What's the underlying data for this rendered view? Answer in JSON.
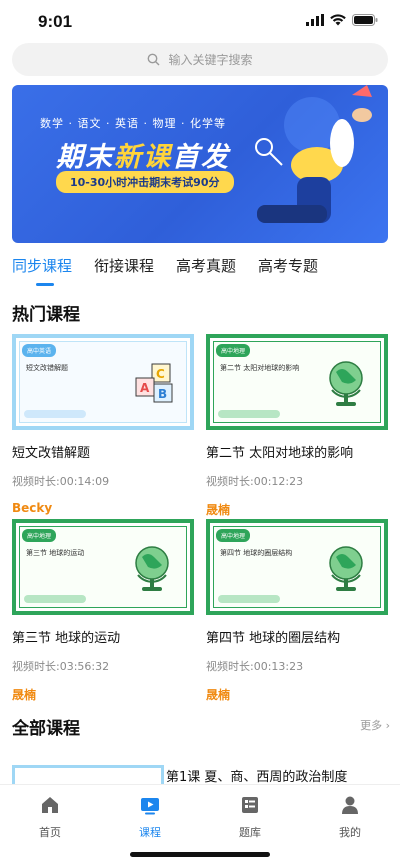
{
  "status": {
    "time": "9:01"
  },
  "search": {
    "placeholder": "输入关键字搜索"
  },
  "banner": {
    "subjects": "数学 · 语文 · 英语 · 物理 · 化学等",
    "headline_pre": "期末",
    "headline_hl": "新课",
    "headline_post": "首发",
    "pill": "10-30小时冲击期末考试90分"
  },
  "tabs": [
    {
      "label": "同步课程",
      "active": true
    },
    {
      "label": "衔接课程"
    },
    {
      "label": "高考真题"
    },
    {
      "label": "高考专题"
    }
  ],
  "hot": {
    "title": "热门课程",
    "courses": [
      {
        "tag": "高中英语",
        "thumb_title": "短文改错解题",
        "name": "短文改错解题",
        "duration": "视频时长:00:14:09",
        "teacher": "Becky"
      },
      {
        "tag": "高中地理",
        "thumb_title": "第二节 太阳对地球的影响",
        "name": "第二节 太阳对地球的影响",
        "duration": "视频时长:00:12:23",
        "teacher": "晟楠"
      },
      {
        "tag": "高中地理",
        "thumb_title": "第三节 地球的运动",
        "name": "第三节 地球的运动",
        "duration": "视频时长:03:56:32",
        "teacher": "晟楠"
      },
      {
        "tag": "高中地理",
        "thumb_title": "第四节 地球的圈层结构",
        "name": "第四节 地球的圈层结构",
        "duration": "视频时长:00:13:23",
        "teacher": "晟楠"
      }
    ]
  },
  "all": {
    "title": "全部课程",
    "more": "更多 ›",
    "first_title": "第1课 夏、商、西周的政治制度"
  },
  "tabbar": [
    {
      "label": "首页",
      "icon": "home-icon"
    },
    {
      "label": "课程",
      "icon": "course-icon",
      "active": true
    },
    {
      "label": "题库",
      "icon": "question-bank-icon"
    },
    {
      "label": "我的",
      "icon": "profile-icon"
    }
  ],
  "colors": {
    "accent": "#1c86ee",
    "teacher": "#f08a12",
    "green": "#2ea55a"
  }
}
